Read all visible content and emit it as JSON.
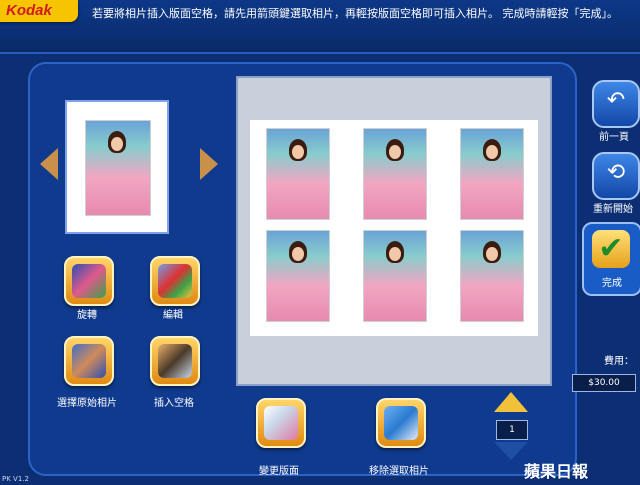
{
  "app": {
    "logo": "Kodak",
    "version": "PK V1.2"
  },
  "instruction": "若要將相片插入版面空格，請先用箭頭鍵選取相片，再輕按版面空格即可插入相片。 完成時請輕按「完成」。",
  "left_panel": {
    "tools": [
      {
        "id": "rotate",
        "label": "旋轉",
        "icon": "rotate-icon"
      },
      {
        "id": "edit",
        "label": "編輯",
        "icon": "edit-tools-icon"
      },
      {
        "id": "select-source",
        "label": "選擇原始相片",
        "icon": "photos-stack-icon"
      },
      {
        "id": "insert",
        "label": "插入空格",
        "icon": "insert-frame-icon"
      }
    ]
  },
  "bottom_actions": [
    {
      "id": "change-layout",
      "label": "變更版面",
      "icon": "layout-icon"
    },
    {
      "id": "remove-selected",
      "label": "移除選取相片",
      "icon": "trash-icon"
    }
  ],
  "right_panel": {
    "prev_label": "前一頁",
    "restart_label": "重新開始",
    "done_label": "完成",
    "fee_label": "費用：",
    "fee_value": "$30.00"
  },
  "pager": {
    "value": "1"
  },
  "watermark": "蘋果日報",
  "colors": {
    "accent": "#f2c13b",
    "panel": "#0f3a8e",
    "background": "#0c2f74"
  }
}
